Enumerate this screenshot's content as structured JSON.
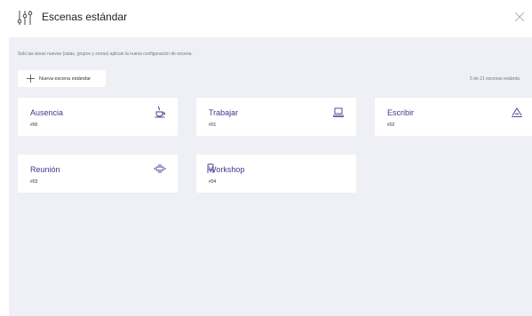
{
  "header": {
    "title": "Escenas estándar",
    "icon": "sliders-icon",
    "close_icon": "close-icon"
  },
  "info_text": "Solo las áreas nuevas (salas, grupos y zonas) aplican la nueva configuración de escena.",
  "new_button": {
    "label": "Nueva escena estándar",
    "icon": "plus-icon"
  },
  "count_text": "5 de 21 escenas estánda",
  "scenes": [
    {
      "name": "Ausencia",
      "number": "#00",
      "icon": "coffee-cup-icon"
    },
    {
      "name": "Trabajar",
      "number": "#01",
      "icon": "laptop-icon"
    },
    {
      "name": "Escribir",
      "number": "#02",
      "icon": "writing-icon"
    },
    {
      "name": "Reunión",
      "number": "#03",
      "icon": "meeting-table-icon"
    },
    {
      "name": "Workshop",
      "number": "#04",
      "icon": "chair-icon"
    }
  ],
  "colors": {
    "accent": "#3f3a8c",
    "background": "#eef0f5",
    "card": "#ffffff"
  }
}
